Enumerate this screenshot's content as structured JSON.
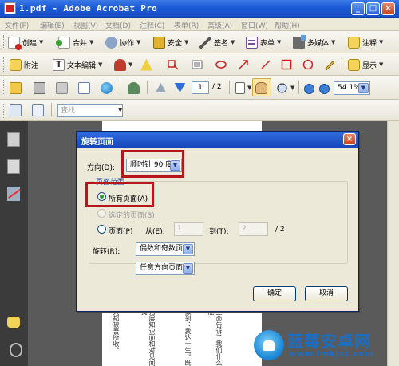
{
  "window": {
    "title": "1.pdf - Adobe Acrobat Pro",
    "min_symbol": "_",
    "max_symbol": "□",
    "close_symbol": "×"
  },
  "menu": [
    "文件(F)",
    "编辑(E)",
    "视图(V)",
    "文档(D)",
    "注释(C)",
    "表单(R)",
    "高级(A)",
    "窗口(W)",
    "帮助(H)"
  ],
  "toolbar_main": {
    "create": "创建",
    "merge": "合并",
    "collaborate": "协作",
    "secure": "安全",
    "sign": "签名",
    "forms": "表单",
    "multimedia": "多媒体",
    "comment": "注释"
  },
  "toolbar_comment": {
    "sticky_note": "附注",
    "text_edit": "文本编辑",
    "show": "显示"
  },
  "toolbar_nav": {
    "page_current": "1",
    "page_total": "/ 2",
    "zoom": "54.1%"
  },
  "toolbar_find": {
    "search_placeholder": "查找"
  },
  "document_text": {
    "col1": "天都被吾所收。",
    "col2": "拓展知识面和对见闻我",
    "col3": "做到：我达一生。既",
    "col4": "生命告诉了我们什么能"
  },
  "dialog": {
    "title": "旋转页面",
    "close_symbol": "×",
    "direction_label": "方向(D):",
    "direction_value": "顺时针 90 度",
    "page_range_title": "页面范围",
    "all_pages": "所有页面(A)",
    "selected_pages": "选定的页面(S)",
    "pages": "页面(P)",
    "from_label": "从(E):",
    "from_value": "1",
    "to_label": "到(T):",
    "to_value": "2",
    "total": "/ 2",
    "rotate_label": "旋转(R):",
    "rotate_value": "偶数和奇数页",
    "orientation_value": "任意方向页面",
    "ok": "确定",
    "cancel": "取消"
  },
  "watermark": {
    "brand": "蓝莓安卓网",
    "url": "www.lmkjst.com"
  },
  "colors": {
    "highlight_box": "#b3171c",
    "titlebar": "#1c5ad6"
  }
}
